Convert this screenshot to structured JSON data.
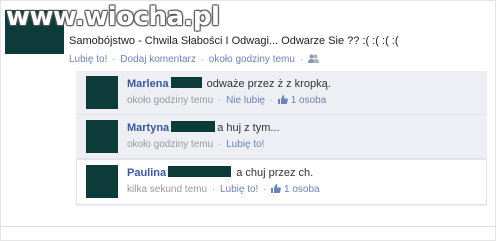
{
  "watermark": "www.wiocha.pl",
  "post": {
    "text": "Samobójstwo - Chwila Słabości I Odwagi... Odwarze Sie ?? :( :( :( :(",
    "like_label": "Lubię to!",
    "comment_label": "Dodaj komentarz",
    "time": "około godziny temu",
    "separator": "·"
  },
  "comments": [
    {
      "name": "Marlena",
      "text": "odważe przez ż z kropką.",
      "time": "około godziny temu",
      "action": "Nie lubię",
      "likes": "1 osoba"
    },
    {
      "name": "Martyna",
      "text": "a huj z tym...",
      "time": "około godziny temu",
      "action": "Lubię to!"
    },
    {
      "name": "Paulina",
      "text": "a chuj przez ch.",
      "time": "kilka sekund temu",
      "action": "Lubię to!",
      "likes": "1 osoba"
    }
  ],
  "icons": {
    "like": "thumbs-up-icon",
    "audience": "friends-icon"
  },
  "colors": {
    "link": "#3b5998",
    "avatar": "#0c3b39",
    "comment_bg": "#edeff4"
  }
}
